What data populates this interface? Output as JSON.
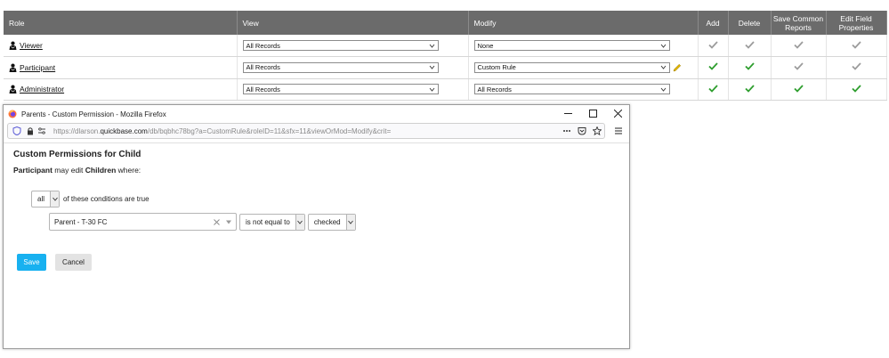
{
  "table": {
    "headers": [
      "Role",
      "View",
      "Modify",
      "Add",
      "Delete",
      "Save Common Reports",
      "Edit Field Properties"
    ],
    "rows": [
      {
        "role": "Viewer",
        "view": "All Records",
        "modify": "None",
        "add": "grey-check",
        "delete": "grey-check",
        "save_common": "grey-check",
        "edit_field": "grey-check",
        "edit_icon": false
      },
      {
        "role": "Participant",
        "view": "All Records",
        "modify": "Custom Rule",
        "add": "green-check",
        "delete": "green-check",
        "save_common": "grey-check",
        "edit_field": "grey-check",
        "edit_icon": true
      },
      {
        "role": "Administrator",
        "view": "All Records",
        "modify": "All Records",
        "add": "green-check",
        "delete": "green-check",
        "save_common": "green-check",
        "edit_field": "green-check",
        "edit_icon": false
      }
    ]
  },
  "window": {
    "title": "Parents - Custom Permission - Mozilla Firefox",
    "url_prefix": "https://dlarson.",
    "url_host": "quickbase.com",
    "url_suffix": "/db/bqbhc78bg?a=CustomRule&roleID=11&sfx=11&viewOrMod=Modify&crit="
  },
  "dialog": {
    "title": "Custom Permissions for Child",
    "subtitle_role": "Participant",
    "subtitle_mid": " may edit ",
    "subtitle_table": "Children",
    "subtitle_end": " where:",
    "match_mode": "all",
    "match_text": "of these conditions are true",
    "field": "Parent - T-30 FC",
    "operator": "is not equal to",
    "value": "checked",
    "save_label": "Save",
    "cancel_label": "Cancel"
  },
  "colors": {
    "header_bg": "#6b6b6b",
    "green_check": "#2e9e2e",
    "grey_check": "#9c9c9c",
    "save_btn": "#18b1f0"
  }
}
